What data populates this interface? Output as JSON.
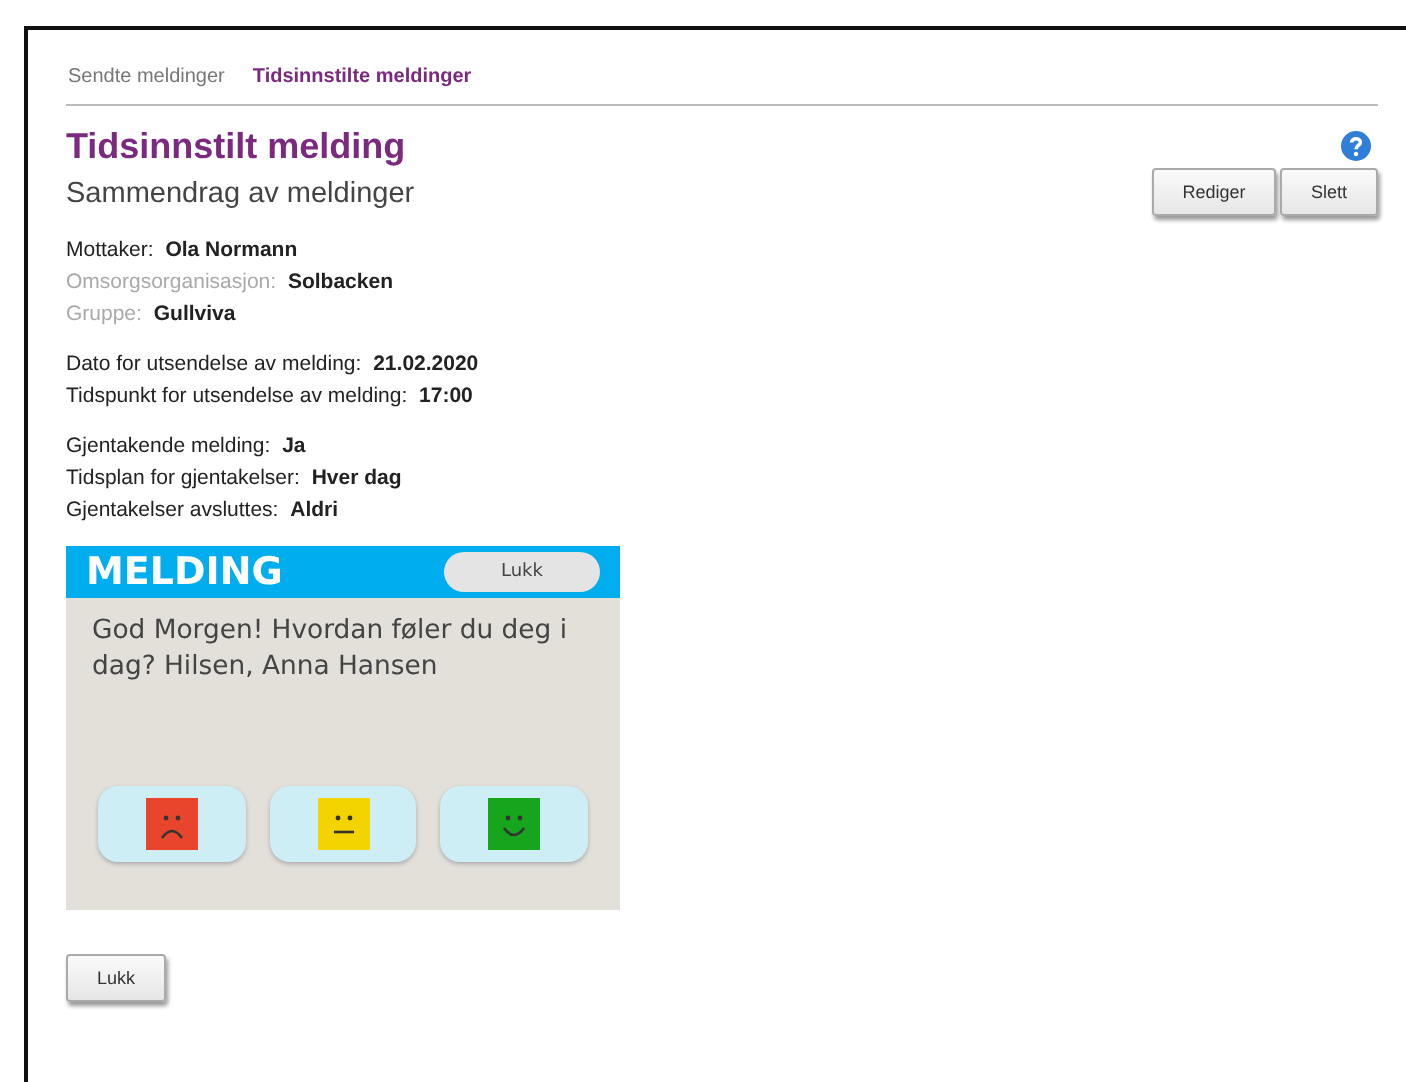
{
  "tabs": [
    {
      "label": "Sendte meldinger",
      "selected": false
    },
    {
      "label": "Tidsinnstilte meldinger",
      "selected": true
    }
  ],
  "title": "Tidsinnstilt melding",
  "subtitle": "Sammendrag av meldinger",
  "actions": [
    "Rediger",
    "Slett"
  ],
  "field_groups": [
    [
      {
        "label": "Mottaker:",
        "value": "Ola Normann",
        "disabled": false
      },
      {
        "label": "Omsorgsorganisasjon:",
        "value": "Solbacken",
        "disabled": true
      },
      {
        "label": "Gruppe:",
        "value": "Gullviva",
        "disabled": true
      }
    ],
    [
      {
        "label": "Dato for utsendelse av melding:",
        "value": "21.02.2020",
        "disabled": false
      },
      {
        "label": "Tidspunkt for utsendelse av melding:",
        "value": "17:00",
        "disabled": false
      }
    ],
    [
      {
        "label": "Gjentakende melding:",
        "value": "Ja",
        "disabled": false
      },
      {
        "label": "Tidsplan for gjentakelser:",
        "value": "Hver dag",
        "disabled": false
      },
      {
        "label": "Gjentakelser avsluttes:",
        "value": "Aldri",
        "disabled": false
      }
    ]
  ],
  "preview": {
    "header": "MELDING",
    "close": "Lukk",
    "message": "God Morgen! Hvordan føler du deg i dag? Hilsen, Anna Hansen",
    "moods": [
      {
        "kind": "sad"
      },
      {
        "kind": "neutral"
      },
      {
        "kind": "happy"
      }
    ]
  },
  "close_button": "Lukk"
}
